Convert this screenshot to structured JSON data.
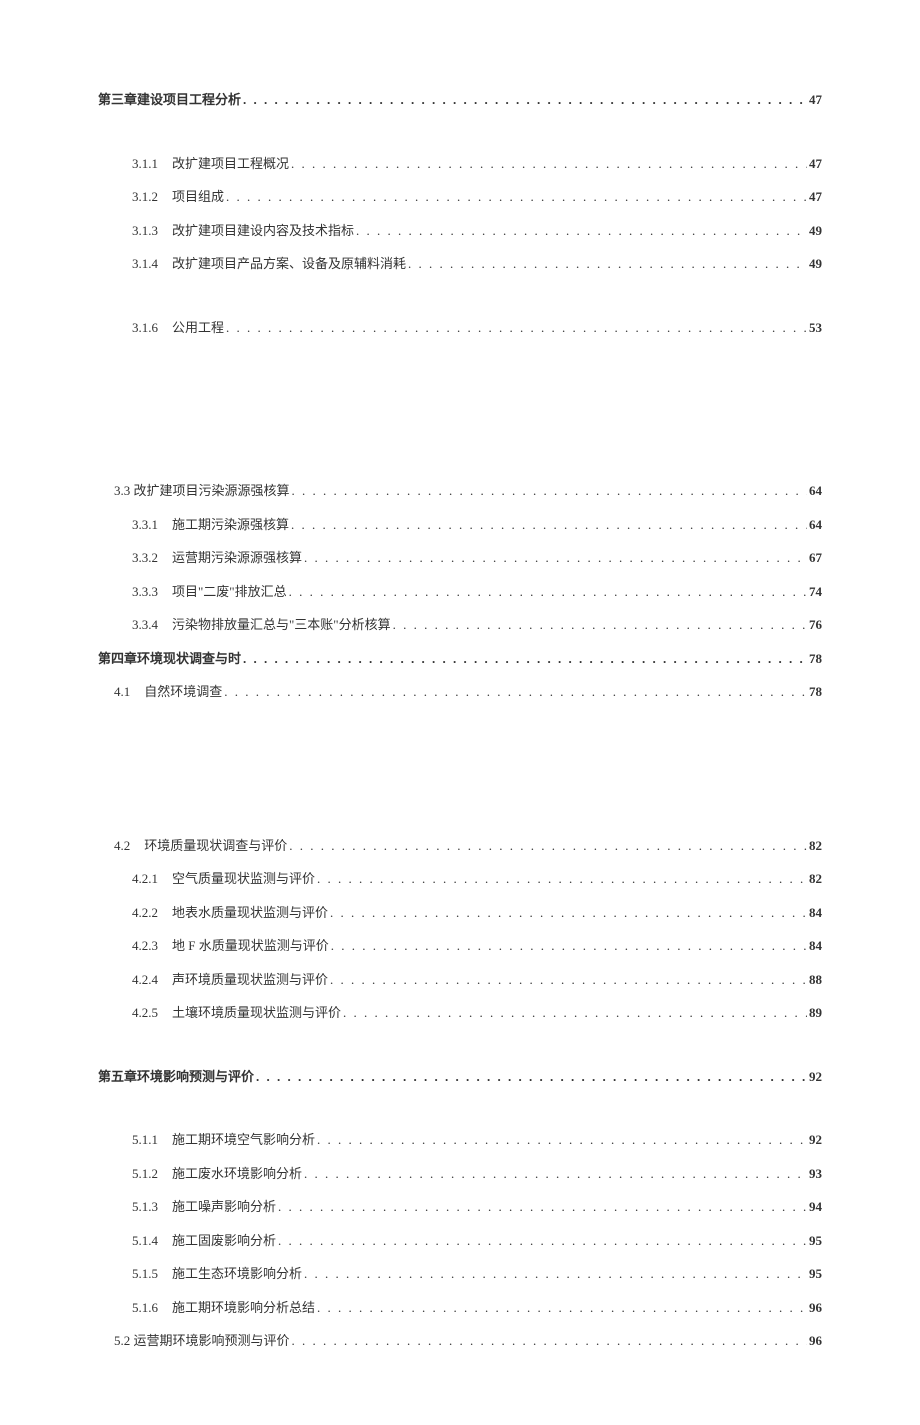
{
  "toc": [
    {
      "level": 0,
      "num": "",
      "title": "第三章建设项目工程分析",
      "page": "47",
      "bold": true,
      "gap_after": 30
    },
    {
      "level": 2,
      "num": "3.1.1",
      "title": "改扩建项目工程概况",
      "page": "47",
      "bold": false,
      "gap_after": 0
    },
    {
      "level": 2,
      "num": "3.1.2",
      "title": "项目组成",
      "page": "47",
      "bold": false,
      "gap_after": 0
    },
    {
      "level": 2,
      "num": "3.1.3",
      "title": "改扩建项目建设内容及技术指标",
      "page": "49",
      "bold": false,
      "gap_after": 0
    },
    {
      "level": 2,
      "num": "3.1.4",
      "title": "改扩建项目产品方案、设备及原辅料消耗",
      "page": "49",
      "bold": false,
      "gap_after": 30
    },
    {
      "level": 2,
      "num": "3.1.6",
      "title": "公用工程",
      "page": "53",
      "bold": false,
      "gap_after": 130
    },
    {
      "level": 1,
      "num": "",
      "title": "3.3 改扩建项目污染源源强核算",
      "page": "64",
      "bold": false,
      "gap_after": 0
    },
    {
      "level": 2,
      "num": "3.3.1",
      "title": "施工期污染源强核算",
      "page": "64",
      "bold": false,
      "gap_after": 0
    },
    {
      "level": 2,
      "num": "3.3.2",
      "title": "运营期污染源源强核算",
      "page": "67",
      "bold": false,
      "gap_after": 0
    },
    {
      "level": 2,
      "num": "3.3.3",
      "title": "项目\"二废\"排放汇总",
      "page": "74",
      "bold": false,
      "gap_after": 0
    },
    {
      "level": 2,
      "num": "3.3.4",
      "title": "污染物排放量汇总与\"三本账\"分析核算",
      "page": "76",
      "bold": false,
      "gap_after": 0
    },
    {
      "level": 0,
      "num": "",
      "title": "第四章环境现状调查与时",
      "page": "78",
      "bold": true,
      "gap_after": 0
    },
    {
      "level": 1,
      "num": "4.1",
      "title": "自然环境调查",
      "page": "78",
      "bold": false,
      "gap_after": 120
    },
    {
      "level": 1,
      "num": "4.2",
      "title": "环境质量现状调查与评价",
      "page": "82",
      "bold": false,
      "gap_after": 0
    },
    {
      "level": 2,
      "num": "4.2.1",
      "title": "空气质量现状监测与评价",
      "page": "82",
      "bold": false,
      "gap_after": 0
    },
    {
      "level": 2,
      "num": "4.2.2",
      "title": "地表水质量现状监测与评价",
      "page": "84",
      "bold": false,
      "gap_after": 0
    },
    {
      "level": 2,
      "num": "4.2.3",
      "title": "地 F 水质量现状监测与评价",
      "page": "84",
      "bold": false,
      "gap_after": 0
    },
    {
      "level": 2,
      "num": "4.2.4",
      "title": "声环境质量现状监测与评价",
      "page": "88",
      "bold": false,
      "gap_after": 0
    },
    {
      "level": 2,
      "num": "4.2.5",
      "title": "土壤环境质量现状监测与评价",
      "page": "89",
      "bold": false,
      "gap_after": 30
    },
    {
      "level": 0,
      "num": "",
      "title": "第五章环境影响预测与评价",
      "page": "92",
      "bold": true,
      "gap_after": 30
    },
    {
      "level": 2,
      "num": "5.1.1",
      "title": "施工期环境空气影响分析",
      "page": "92",
      "bold": false,
      "gap_after": 0
    },
    {
      "level": 2,
      "num": "5.1.2",
      "title": "施工废水环境影响分析",
      "page": "93",
      "bold": false,
      "gap_after": 0
    },
    {
      "level": 2,
      "num": "5.1.3",
      "title": "施工噪声影响分析",
      "page": "94",
      "bold": false,
      "gap_after": 0
    },
    {
      "level": 2,
      "num": "5.1.4",
      "title": "施工固废影响分析",
      "page": "95",
      "bold": false,
      "gap_after": 0
    },
    {
      "level": 2,
      "num": "5.1.5",
      "title": "施工生态环境影响分析",
      "page": "95",
      "bold": false,
      "gap_after": 0
    },
    {
      "level": 2,
      "num": "5.1.6",
      "title": "施工期环境影响分析总结",
      "page": "96",
      "bold": false,
      "gap_after": 0
    },
    {
      "level": 1,
      "num": "",
      "title": "5.2 运营期环境影响预测与评价",
      "page": "96",
      "bold": false,
      "gap_after": 0
    }
  ]
}
